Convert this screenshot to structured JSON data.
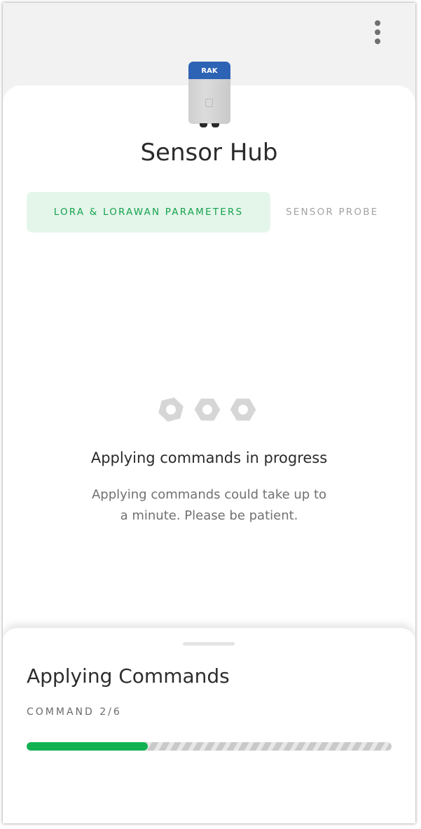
{
  "header": {
    "device_badge": "RAK",
    "device_title": "Sensor Hub"
  },
  "tabs": [
    {
      "label": "LORA & LORAWAN PARAMETERS",
      "active": true
    },
    {
      "label": "SENSOR PROBE",
      "active": false
    }
  ],
  "status": {
    "title": "Applying commands in progress",
    "description_line1": "Applying commands could take up to",
    "description_line2": "a minute. Please be patient."
  },
  "sheet": {
    "title": "Applying Commands",
    "command_progress": "COMMAND 2/6",
    "progress_fraction": 0.333
  },
  "colors": {
    "accent_green": "#12b252",
    "tab_active_bg": "#e4f6ea",
    "device_blue": "#2d63b5"
  }
}
